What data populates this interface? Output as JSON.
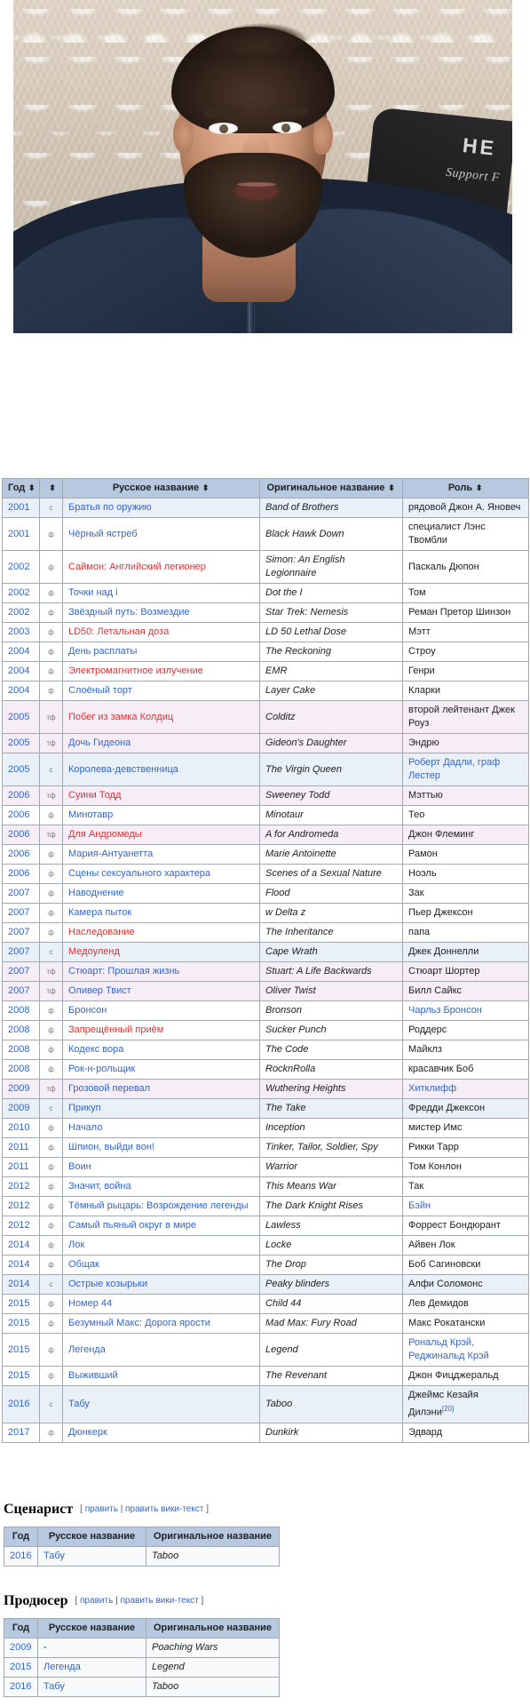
{
  "photo": {
    "alt": "Портретное фото бородатого мужчины в тёмно-синем свитере на фоне кружевной занавески",
    "shirt_print_line1": "HE",
    "shirt_print_line2": "Support F"
  },
  "film_table": {
    "headers": [
      {
        "label": "Год",
        "sortable": true
      },
      {
        "label": "",
        "sortable": true
      },
      {
        "label": "Русское название",
        "sortable": true
      },
      {
        "label": "Оригинальное название",
        "sortable": true
      },
      {
        "label": "Роль",
        "sortable": true
      }
    ],
    "sort_icon": "⬍",
    "rows": [
      {
        "year": "2001",
        "kind": "с",
        "ru": "Братья по оружию",
        "ru_link": "blue",
        "orig": "Band of Brothers",
        "role": "рядовой Джон А. Яновеч",
        "role_link": "none"
      },
      {
        "year": "2001",
        "kind": "ф",
        "ru": "Чёрный ястреб",
        "ru_link": "blue",
        "orig": "Black Hawk Down",
        "role": "специалист Лэнс Твомбли",
        "role_link": "none"
      },
      {
        "year": "2002",
        "kind": "ф",
        "ru": "Саймон: Английский легионер",
        "ru_link": "red",
        "orig": "Simon: An English Legionnaire",
        "role": "Паскаль Дюпон",
        "role_link": "none"
      },
      {
        "year": "2002",
        "kind": "ф",
        "ru": "Точки над i",
        "ru_link": "blue",
        "orig": "Dot the I",
        "role": "Том",
        "role_link": "none"
      },
      {
        "year": "2002",
        "kind": "ф",
        "ru": "Звёздный путь: Возмездие",
        "ru_link": "blue",
        "orig": "Star Trek: Nemesis",
        "role": "Реман Претор Шинзон",
        "role_link": "none"
      },
      {
        "year": "2003",
        "kind": "ф",
        "ru": "LD50: Летальная доза",
        "ru_link": "red",
        "orig": "LD 50 Lethal Dose",
        "role": "Мэтт",
        "role_link": "none"
      },
      {
        "year": "2004",
        "kind": "ф",
        "ru": "День расплаты",
        "ru_link": "blue",
        "orig": "The Reckoning",
        "role": "Строу",
        "role_link": "none"
      },
      {
        "year": "2004",
        "kind": "ф",
        "ru": "Электромагнитное излучение",
        "ru_link": "red",
        "orig": "EMR",
        "role": "Генри",
        "role_link": "none"
      },
      {
        "year": "2004",
        "kind": "ф",
        "ru": "Слоёный торт",
        "ru_link": "blue",
        "orig": "Layer Cake",
        "role": "Кларки",
        "role_link": "none"
      },
      {
        "year": "2005",
        "kind": "тф",
        "ru": "Побег из замка Колдиц",
        "ru_link": "red",
        "orig": "Colditz",
        "role": "второй лейтенант Джек Роуз",
        "role_link": "none"
      },
      {
        "year": "2005",
        "kind": "тф",
        "ru": "Дочь Гидеона",
        "ru_link": "blue",
        "orig": "Gideon's Daughter",
        "role": "Эндрю",
        "role_link": "none"
      },
      {
        "year": "2005",
        "kind": "с",
        "ru": "Королева-девственница",
        "ru_link": "blue",
        "orig": "The Virgin Queen",
        "role": "Роберт Дадли, граф Лестер",
        "role_link": "blue"
      },
      {
        "year": "2006",
        "kind": "тф",
        "ru": "Суини Тодд",
        "ru_link": "red",
        "orig": "Sweeney Todd",
        "role": "Мэттью",
        "role_link": "none"
      },
      {
        "year": "2006",
        "kind": "ф",
        "ru": "Минотавр",
        "ru_link": "blue",
        "orig": "Minotaur",
        "role": "Тео",
        "role_link": "none"
      },
      {
        "year": "2006",
        "kind": "тф",
        "ru": "Для Андромеды",
        "ru_link": "red",
        "orig": "A for Andromeda",
        "role": "Джон Флеминг",
        "role_link": "none"
      },
      {
        "year": "2006",
        "kind": "ф",
        "ru": "Мария-Антуанетта",
        "ru_link": "blue",
        "orig": "Marie Antoinette",
        "role": "Рамон",
        "role_link": "none"
      },
      {
        "year": "2006",
        "kind": "ф",
        "ru": "Сцены сексуального характера",
        "ru_link": "blue",
        "orig": "Scenes of a Sexual Nature",
        "role": "Ноэль",
        "role_link": "none"
      },
      {
        "year": "2007",
        "kind": "ф",
        "ru": "Наводнение",
        "ru_link": "blue",
        "orig": "Flood",
        "role": "Зак",
        "role_link": "none"
      },
      {
        "year": "2007",
        "kind": "ф",
        "ru": "Камера пыток",
        "ru_link": "blue",
        "orig": "w Delta z",
        "role": "Пьер Джексон",
        "role_link": "none"
      },
      {
        "year": "2007",
        "kind": "ф",
        "ru": "Наследование",
        "ru_link": "red",
        "orig": "The Inheritance",
        "role": "папа",
        "role_link": "none"
      },
      {
        "year": "2007",
        "kind": "с",
        "ru": "Медоуленд",
        "ru_link": "red",
        "orig": "Cape Wrath",
        "role": "Джек Доннелли",
        "role_link": "none"
      },
      {
        "year": "2007",
        "kind": "тф",
        "ru": "Стюарт: Прошлая жизнь",
        "ru_link": "blue",
        "orig": "Stuart: A Life Backwards",
        "role": "Стюарт Шортер",
        "role_link": "none"
      },
      {
        "year": "2007",
        "kind": "тф",
        "ru": "Оливер Твист",
        "ru_link": "blue",
        "orig": "Oliver Twist",
        "role": "Билл Сайкс",
        "role_link": "none"
      },
      {
        "year": "2008",
        "kind": "ф",
        "ru": "Бронсон",
        "ru_link": "blue",
        "orig": "Bronson",
        "role": "Чарльз Бронсон",
        "role_link": "blue"
      },
      {
        "year": "2008",
        "kind": "ф",
        "ru": "Запрещённый приём",
        "ru_link": "red",
        "orig": "Sucker Punch",
        "role": "Роддерс",
        "role_link": "none"
      },
      {
        "year": "2008",
        "kind": "ф",
        "ru": "Кодекс вора",
        "ru_link": "blue",
        "orig": "The Code",
        "role": "Майклз",
        "role_link": "none"
      },
      {
        "year": "2008",
        "kind": "ф",
        "ru": "Рок-н-рольщик",
        "ru_link": "blue",
        "orig": "RocknRolla",
        "role": "красавчик Боб",
        "role_link": "none"
      },
      {
        "year": "2009",
        "kind": "тф",
        "ru": "Грозовой перевал",
        "ru_link": "blue",
        "orig": "Wuthering Heights",
        "role": "Хитклифф",
        "role_link": "blue"
      },
      {
        "year": "2009",
        "kind": "с",
        "ru": "Прикуп",
        "ru_link": "blue",
        "orig": "The Take",
        "role": "Фредди Джексон",
        "role_link": "none"
      },
      {
        "year": "2010",
        "kind": "ф",
        "ru": "Начало",
        "ru_link": "blue",
        "orig": "Inception",
        "role": "мистер Имс",
        "role_link": "none"
      },
      {
        "year": "2011",
        "kind": "ф",
        "ru": "Шпион, выйди вон!",
        "ru_link": "blue",
        "orig": "Tinker, Tailor, Soldier, Spy",
        "role": "Рикки Тарр",
        "role_link": "none"
      },
      {
        "year": "2011",
        "kind": "ф",
        "ru": "Воин",
        "ru_link": "blue",
        "orig": "Warrior",
        "role": "Том Конлон",
        "role_link": "none"
      },
      {
        "year": "2012",
        "kind": "ф",
        "ru": "Значит, война",
        "ru_link": "blue",
        "orig": "This Means War",
        "role": "Так",
        "role_link": "none"
      },
      {
        "year": "2012",
        "kind": "ф",
        "ru": "Тёмный рыцарь: Возрождение легенды",
        "ru_link": "blue",
        "orig": "The Dark Knight Rises",
        "role": "Бэйн",
        "role_link": "blue"
      },
      {
        "year": "2012",
        "kind": "ф",
        "ru": "Самый пьяный округ в мире",
        "ru_link": "blue",
        "orig": "Lawless",
        "role": "Форрест Бондюрант",
        "role_link": "none"
      },
      {
        "year": "2014",
        "kind": "ф",
        "ru": "Лок",
        "ru_link": "blue",
        "orig": "Locke",
        "role": "Айвен Лок",
        "role_link": "none"
      },
      {
        "year": "2014",
        "kind": "ф",
        "ru": "Общак",
        "ru_link": "blue",
        "orig": "The Drop",
        "role": "Боб Сагиновски",
        "role_link": "none"
      },
      {
        "year": "2014",
        "kind": "с",
        "ru": "Острые козырьки",
        "ru_link": "blue",
        "orig": "Peaky blinders",
        "role": "Алфи Соломонс",
        "role_link": "none"
      },
      {
        "year": "2015",
        "kind": "ф",
        "ru": "Номер 44",
        "ru_link": "blue",
        "orig": "Child 44",
        "role": "Лев Демидов",
        "role_link": "none"
      },
      {
        "year": "2015",
        "kind": "ф",
        "ru": "Безумный Макс: Дорога ярости",
        "ru_link": "blue",
        "orig": "Mad Max: Fury Road",
        "role": "Макс Рокатански",
        "role_link": "none"
      },
      {
        "year": "2015",
        "kind": "ф",
        "ru": "Легенда",
        "ru_link": "blue",
        "orig": "Legend",
        "role": "Рональд Крэй, Реджинальд Крэй",
        "role_link": "blue"
      },
      {
        "year": "2015",
        "kind": "ф",
        "ru": "Выживший",
        "ru_link": "blue",
        "orig": "The Revenant",
        "role": "Джон Фицджеральд",
        "role_link": "none"
      },
      {
        "year": "2016",
        "kind": "с",
        "ru": "Табу",
        "ru_link": "blue",
        "orig": "Taboo",
        "role": "Джеймс Кезайя Дилэни",
        "role_link": "none",
        "role_ref": "[20]"
      },
      {
        "year": "2017",
        "kind": "ф",
        "ru": "Дюнкерк",
        "ru_link": "blue",
        "orig": "Dunkirk",
        "role": "Эдвард",
        "role_link": "none"
      }
    ]
  },
  "writer_section": {
    "title": "Сценарист",
    "edit_open": "[",
    "edit_label": "править",
    "edit_sep": "|",
    "edit_source_label": "править вики-текст",
    "edit_close": "]",
    "headers": [
      "Год",
      "Русское название",
      "Оригинальное название"
    ],
    "rows": [
      {
        "year": "2016",
        "ru": "Табу",
        "ru_link": "blue",
        "orig": "Taboo"
      }
    ]
  },
  "producer_section": {
    "title": "Продюсер",
    "edit_open": "[",
    "edit_label": "править",
    "edit_sep": "|",
    "edit_source_label": "править вики-текст",
    "edit_close": "]",
    "headers": [
      "Год",
      "Русское название",
      "Оригинальное название"
    ],
    "rows": [
      {
        "year": "2009",
        "ru": "-",
        "ru_link": "none",
        "orig": "Poaching Wars"
      },
      {
        "year": "2015",
        "ru": "Легенда",
        "ru_link": "blue",
        "orig": "Legend"
      },
      {
        "year": "2016",
        "ru": "Табу",
        "ru_link": "blue",
        "orig": "Taboo"
      }
    ]
  },
  "colors": {
    "link_blue": "#3366cc",
    "link_red": "#d33",
    "table_header_bg": "#b6c9e0",
    "table_border": "#a2a9b1",
    "row_series_bg": "#eaf0f8",
    "row_tvmovie_bg": "#f6edf7"
  }
}
